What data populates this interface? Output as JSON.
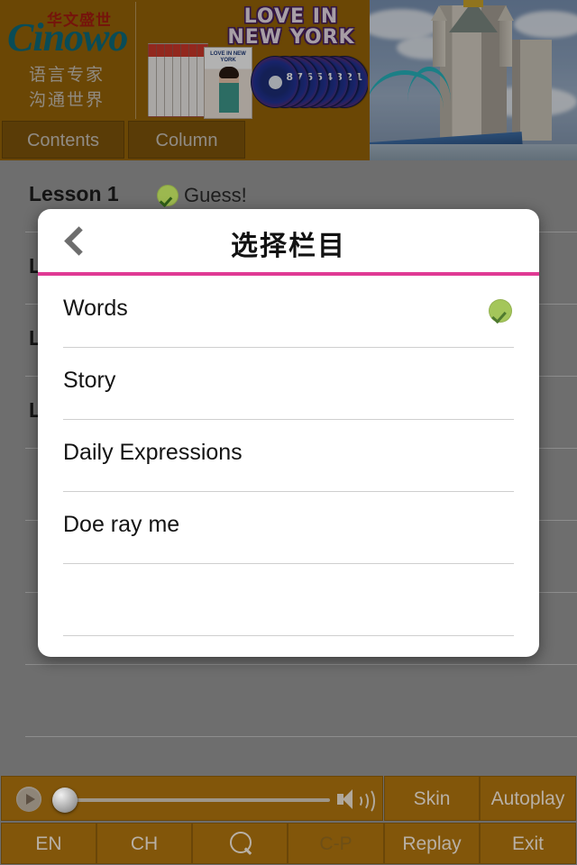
{
  "header": {
    "logo": {
      "chinese_top": "华文盛世",
      "brand": "Cinowo",
      "sub_line_1": "语言专家",
      "sub_line_2": "沟通世界"
    },
    "banner": {
      "title": "LOVE IN\nNEW YORK",
      "disc_numbers": [
        "8",
        "7",
        "6",
        "5",
        "4",
        "3",
        "2",
        "1"
      ],
      "book_cover_title": "LOVE IN NEW YORK"
    },
    "photo_alt": "tower-bridge-photo"
  },
  "tabs": [
    {
      "id": "contents",
      "label": "Contents"
    },
    {
      "id": "column",
      "label": "Column"
    }
  ],
  "background_list": {
    "rows": [
      {
        "label": "Lesson 1",
        "has_check": true,
        "extra": "Guess!"
      },
      {
        "label": "L",
        "has_check": false,
        "extra": ""
      },
      {
        "label": "L",
        "has_check": false,
        "extra": ""
      },
      {
        "label": "L",
        "has_check": false,
        "extra": ""
      }
    ]
  },
  "modal": {
    "title": "选择栏目",
    "back_icon": "chevron-left-icon",
    "accent_color": "#e03a94",
    "check_color": "#a4c65a",
    "options": [
      {
        "label": "Words",
        "selected": true
      },
      {
        "label": "Story",
        "selected": false
      },
      {
        "label": "Daily Expressions",
        "selected": false
      },
      {
        "label": "Doe ray me",
        "selected": false
      }
    ]
  },
  "toolbar": {
    "player": {
      "play_icon": "play-icon",
      "volume_icon": "volume-icon",
      "slider_value": 0
    },
    "row1": [
      {
        "id": "skin",
        "label": "Skin",
        "disabled": false
      },
      {
        "id": "autoplay",
        "label": "Autoplay",
        "disabled": false
      }
    ],
    "row2": [
      {
        "id": "en",
        "label": "EN",
        "disabled": false
      },
      {
        "id": "ch",
        "label": "CH",
        "disabled": false
      },
      {
        "id": "search",
        "label": "",
        "icon": "search-icon",
        "disabled": false
      },
      {
        "id": "cp",
        "label": "C-P",
        "disabled": true
      },
      {
        "id": "replay",
        "label": "Replay",
        "disabled": false
      },
      {
        "id": "exit",
        "label": "Exit",
        "disabled": false
      }
    ]
  },
  "colors": {
    "brand_brown": "#9a6608",
    "toolbar_brown": "#82560a",
    "overlay_gray": "#6e6e6e",
    "accent_pink": "#e03a94",
    "check_green": "#a4c65a"
  }
}
